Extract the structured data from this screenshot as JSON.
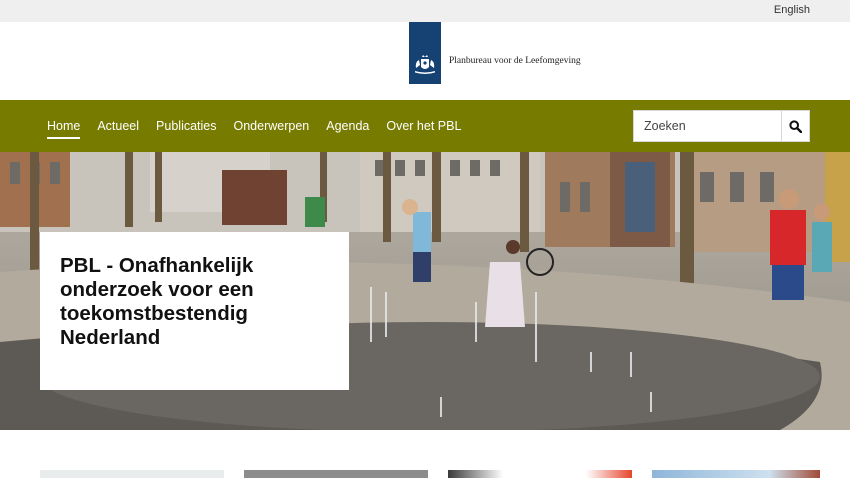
{
  "topbar": {
    "language_link": "English"
  },
  "header": {
    "logo_text": "Planbureau voor de Leefomgeving",
    "logo_icon": "coat-of-arms-icon"
  },
  "nav": {
    "items": [
      {
        "label": "Home",
        "active": true
      },
      {
        "label": "Actueel",
        "active": false
      },
      {
        "label": "Publicaties",
        "active": false
      },
      {
        "label": "Onderwerpen",
        "active": false
      },
      {
        "label": "Agenda",
        "active": false
      },
      {
        "label": "Over het PBL",
        "active": false
      }
    ]
  },
  "search": {
    "placeholder": "Zoeken",
    "button_icon": "search-icon"
  },
  "hero": {
    "title": "PBL - Onafhankelijk onderzoek voor een toekomstbestendig Nederland"
  },
  "colors": {
    "nav_bg": "#777c00",
    "logo_bg": "#154273",
    "topbar_bg": "#efefef"
  }
}
